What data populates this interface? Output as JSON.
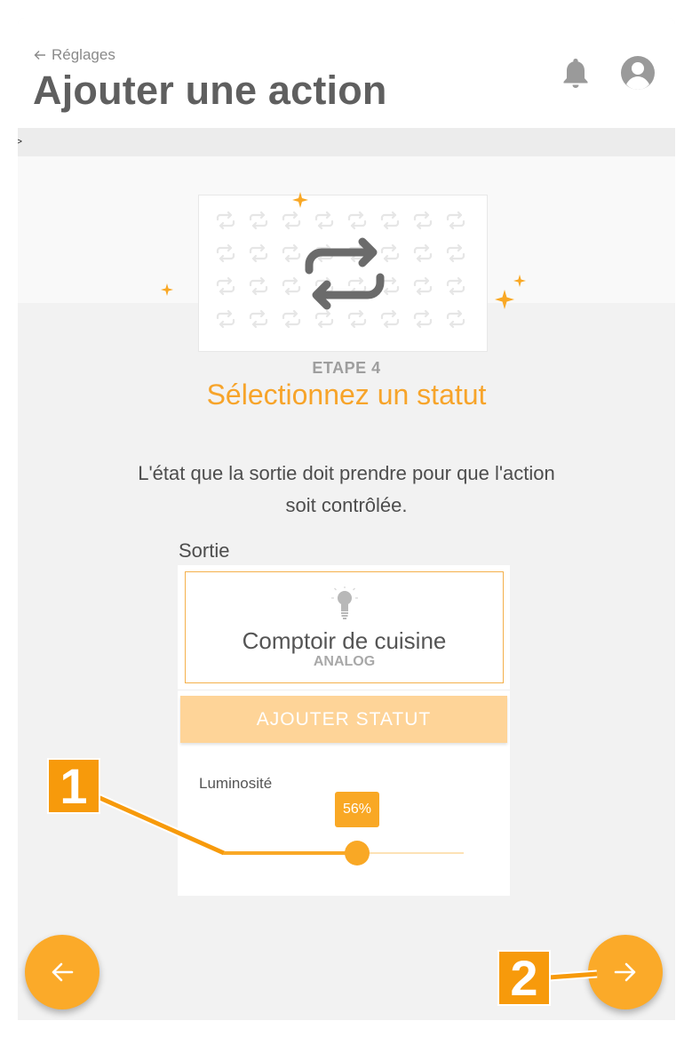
{
  "header": {
    "back_label": "Réglages",
    "title": "Ajouter une action",
    "icons": [
      "arrow-left-icon",
      "bell-icon",
      "user-avatar-icon"
    ]
  },
  "breadcrumb_toggle": ">",
  "step": {
    "label": "ETAPE 4",
    "title": "Sélectionnez un statut",
    "description": "L'état que la sortie doit prendre pour que l'action soit contrôlée.",
    "hero_icon": "repeat-arrows-icon"
  },
  "output": {
    "section_label": "Sortie",
    "name": "Comptoir de cuisine",
    "type": "ANALOG",
    "icon": "lightbulb-icon"
  },
  "add_status_button": "AJOUTER STATUT",
  "luminosity": {
    "label": "Luminosité",
    "value_text": "56%",
    "value": 56
  },
  "nav": {
    "back_icon": "arrow-left-icon",
    "next_icon": "arrow-right-icon"
  },
  "callouts": [
    "1",
    "2"
  ],
  "colors": {
    "accent": "#f9a825",
    "accent_light": "#fed498",
    "title_orange": "#f7a42a",
    "callout": "#f79a0b"
  }
}
